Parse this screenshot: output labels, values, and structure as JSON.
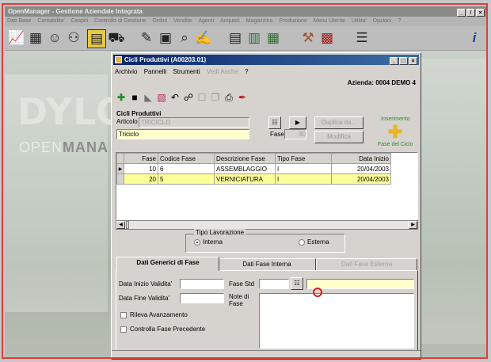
{
  "main_window": {
    "title": "OpenManager - Gestione Aziendale Integrata",
    "menu": [
      "Dati Base",
      "Contabilita'",
      "Cespiti",
      "Controllo di Gestione",
      "Ordini",
      "Vendite",
      "Agenti",
      "Acquisti",
      "Magazzino",
      "Produzione",
      "Menu Utente",
      "Utilita'",
      "Opzioni",
      "?"
    ],
    "controls": [
      "_",
      "̸",
      "×"
    ]
  },
  "background": {
    "logo": "DYLOG",
    "sub_open": "OPEN",
    "sub_mana": "MANA"
  },
  "dialog": {
    "title": "Cicli Produttivi (A00203.01)",
    "controls": [
      "_",
      "□",
      "×"
    ],
    "menu": [
      "Archivio",
      "Pannelli",
      "Strumenti"
    ],
    "menu_disabled": "Vedi Anche",
    "menu_help": "?",
    "azienda": "Azienda: 0004 DEMO 4",
    "section_title": "Cicli Produttivi",
    "articolo_label": "Articolo",
    "articolo_value": "TRICICLO",
    "descrizione_value": "Triciclo",
    "fase_label": "Fase",
    "fase_value": "30",
    "duplica_label": "Duplica da...",
    "modifica_label": "Modifica",
    "inserimento_label": "Inserimento",
    "fase_del_ciclo_label": "Fase del Ciclo",
    "nav_arrow": "▶"
  },
  "grid": {
    "headers": [
      "Fase",
      "Codice Fase",
      "Descrizione Fase",
      "Tipo Fase",
      "Data Inizio"
    ],
    "rows": [
      {
        "fase": "10",
        "codice": "6",
        "descrizione": "ASSEMBLAGGIO",
        "tipo": "I",
        "data": "20/04/2003"
      },
      {
        "fase": "20",
        "codice": "5",
        "descrizione": "VERNICIATURA",
        "tipo": "I",
        "data": "20/04/2003"
      }
    ]
  },
  "tipo_lavorazione": {
    "legend": "Tipo Lavorazione",
    "interna": "Interna",
    "esterna": "Esterna",
    "selected": "Interna"
  },
  "tabs": [
    "Dati Generici di Fase",
    "Dati Fase Interna",
    "Dati Fase Esterna"
  ],
  "form": {
    "data_inizio_label": "Data Inizio Validita'",
    "data_fine_label": "Data Fine Validita'",
    "fase_std_label": "Fase Std",
    "note_label": "Note di Fase",
    "rileva_label": "Rileva Avanzamento",
    "controlla_label": "Controlla Fase Precedente"
  }
}
